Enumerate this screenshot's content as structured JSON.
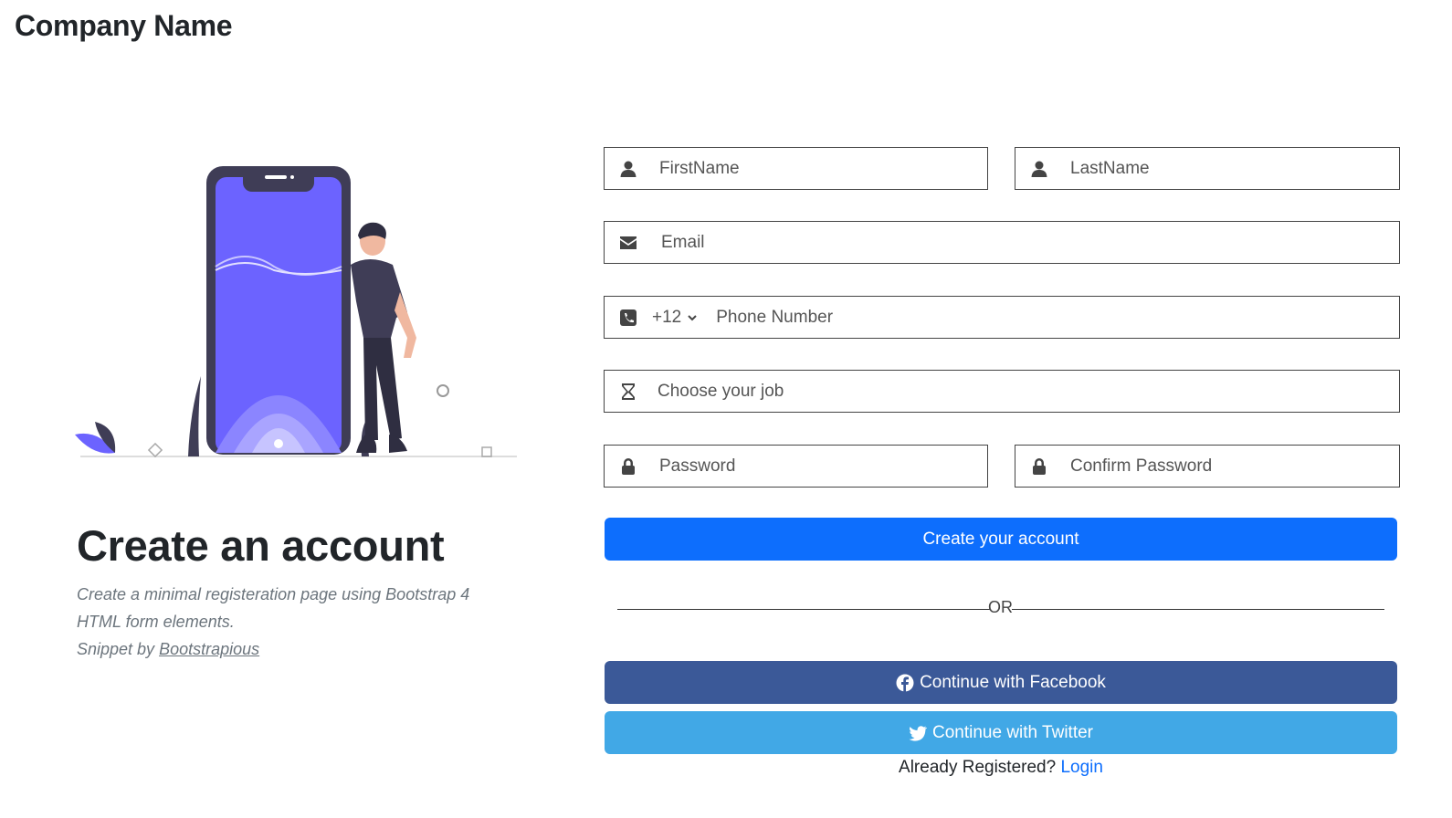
{
  "header": {
    "brand": "Company Name"
  },
  "intro": {
    "title": "Create an account",
    "description": "Create a minimal registeration page using Bootstrap 4 HTML form elements.",
    "credit_prefix": "Snippet by ",
    "credit_link": "Bootstrapious"
  },
  "form": {
    "first_name_placeholder": "FirstName",
    "last_name_placeholder": "LastName",
    "email_placeholder": "Email",
    "country_code": "+12",
    "phone_placeholder": "Phone Number",
    "job_placeholder": "Choose your job",
    "password_placeholder": "Password",
    "confirm_password_placeholder": "Confirm Password",
    "submit_label": "Create your account",
    "divider_label": "OR",
    "facebook_label": "Continue with Facebook",
    "twitter_label": "Continue with Twitter",
    "already_registered": "Already Registered? ",
    "login_link": "Login"
  },
  "colors": {
    "primary": "#0d6efd",
    "facebook": "#3b5998",
    "twitter": "#41a8e6",
    "illustration_accent": "#6c63ff"
  },
  "icons": [
    "user-icon",
    "envelope-icon",
    "phone-icon",
    "chevron-down-icon",
    "hourglass-icon",
    "lock-icon",
    "facebook-icon",
    "twitter-icon"
  ]
}
